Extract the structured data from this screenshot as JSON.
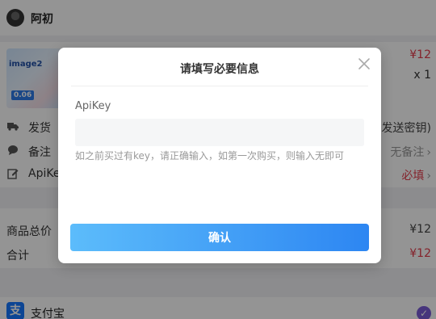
{
  "shop": {
    "name": "阿初"
  },
  "product": {
    "thumb_title": "image2",
    "thumb_badge": "0.06",
    "price": "¥12",
    "quantity": "x 1"
  },
  "rows": [
    {
      "label": "发货",
      "value": "发送密钥)",
      "icon": "truck-icon"
    },
    {
      "label": "备注",
      "value": "无备注",
      "icon": "chat-icon"
    },
    {
      "label": "ApiKey",
      "value": "必填",
      "icon": "edit-icon"
    }
  ],
  "totals": {
    "subtotal_label": "商品总价",
    "subtotal_value": "¥12",
    "total_label": "合计",
    "total_value": "¥12"
  },
  "payment": {
    "name": "支付宝",
    "icon_glyph": "支"
  },
  "modal": {
    "title": "请填写必要信息",
    "field_label": "ApiKey",
    "field_value": "",
    "hint": "如之前买过有key，请正确输入，如第一次购买，则输入无即可",
    "confirm_label": "确认"
  },
  "colors": {
    "accent_red": "#e33b4a",
    "button_start": "#5cbcfb",
    "button_end": "#2d86f2",
    "alipay_blue": "#1677ff"
  }
}
